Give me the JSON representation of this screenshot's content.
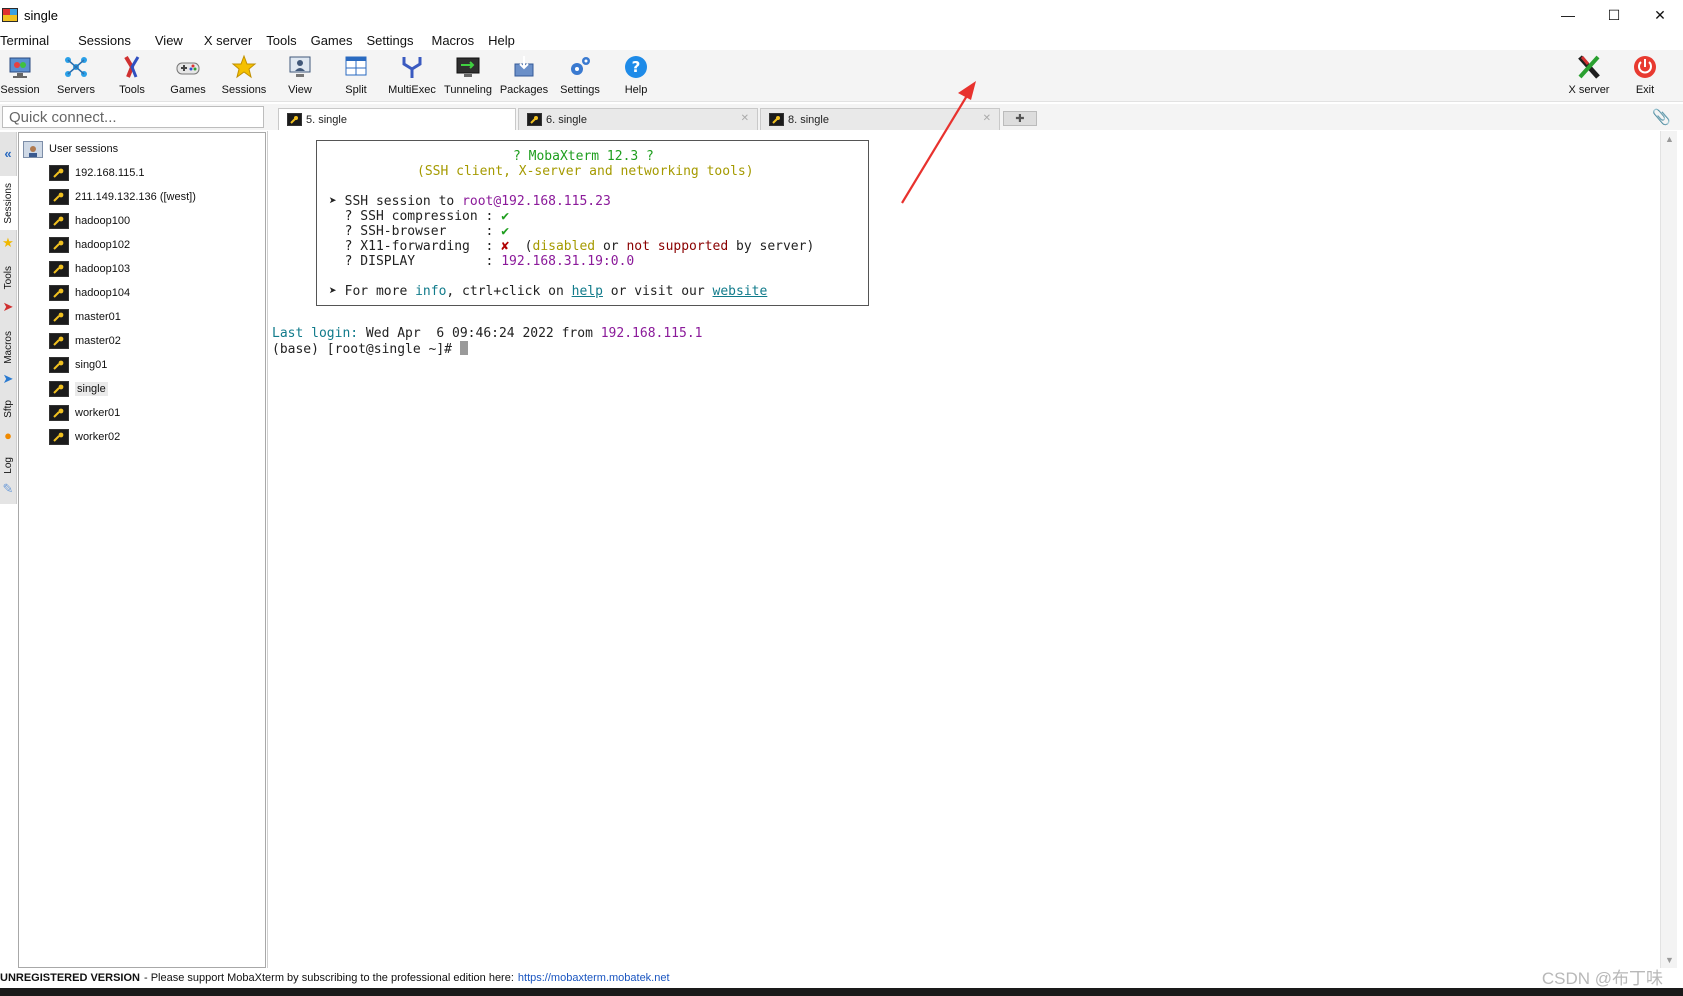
{
  "window": {
    "title": "single"
  },
  "menu": [
    "Terminal",
    "Sessions",
    "View",
    "X server",
    "Tools",
    "Games",
    "Settings",
    "Macros",
    "Help"
  ],
  "toolbar": {
    "session": "Session",
    "servers": "Servers",
    "tools": "Tools",
    "games": "Games",
    "sessions": "Sessions",
    "view": "View",
    "split": "Split",
    "multiexec": "MultiExec",
    "tunneling": "Tunneling",
    "packages": "Packages",
    "settings": "Settings",
    "help": "Help",
    "xserver": "X server",
    "exit": "Exit"
  },
  "quick_connect": {
    "placeholder": "Quick connect..."
  },
  "tabs": [
    "5. single",
    "6. single",
    "8. single"
  ],
  "side_tabs": {
    "sessions": "Sessions",
    "tools": "Tools",
    "macros": "Macros",
    "sftp": "Sftp",
    "log": "Log"
  },
  "sessions_panel": {
    "root": "User sessions",
    "items": [
      "192.168.115.1",
      "211.149.132.136 ([west])",
      "hadoop100",
      "hadoop102",
      "hadoop103",
      "hadoop104",
      "master01",
      "master02",
      "sing01",
      "single",
      "worker01",
      "worker02"
    ],
    "selected": "single"
  },
  "banner": {
    "title": "? MobaXterm 12.3 ?",
    "subtitle": "(SSH client, X-server and networking tools)",
    "ssh_prefix": "➤ SSH session to ",
    "ssh_target": "root@192.168.115.23",
    "rows": [
      {
        "label": "  ? SSH compression : ",
        "mark": "✔"
      },
      {
        "label": "  ? SSH-browser     : ",
        "mark": "✔"
      },
      {
        "label": "  ? X11-forwarding  : ",
        "mark": "✘"
      },
      {
        "label": "  ? DISPLAY         : ",
        "value": "192.168.31.19:0.0"
      }
    ],
    "x11_note": {
      "open": "(",
      "disabled": "disabled",
      "or": " or ",
      "not_supported": "not supported",
      "tail": " by server)"
    },
    "more_prefix": "➤ For more ",
    "info": "info",
    "more_mid": ", ctrl+click on ",
    "help": "help",
    "more_mid2": " or visit our ",
    "website": "website"
  },
  "terminal": {
    "last_login_label": "Last login:",
    "last_login_date": " Wed Apr  6 09:46:24 2022 from ",
    "last_login_ip": "192.168.115.1",
    "prompt": "(base) [root@single ~]# "
  },
  "status": {
    "bold": "UNREGISTERED VERSION",
    "text": " -  Please support MobaXterm by subscribing to the professional edition here:",
    "link": "https://mobaxterm.mobatek.net"
  },
  "watermark": "CSDN @布丁味",
  "colors": {
    "arrow": "#e8322e",
    "link": "#1a55c0",
    "terminal_green": "#1e9e1e"
  }
}
